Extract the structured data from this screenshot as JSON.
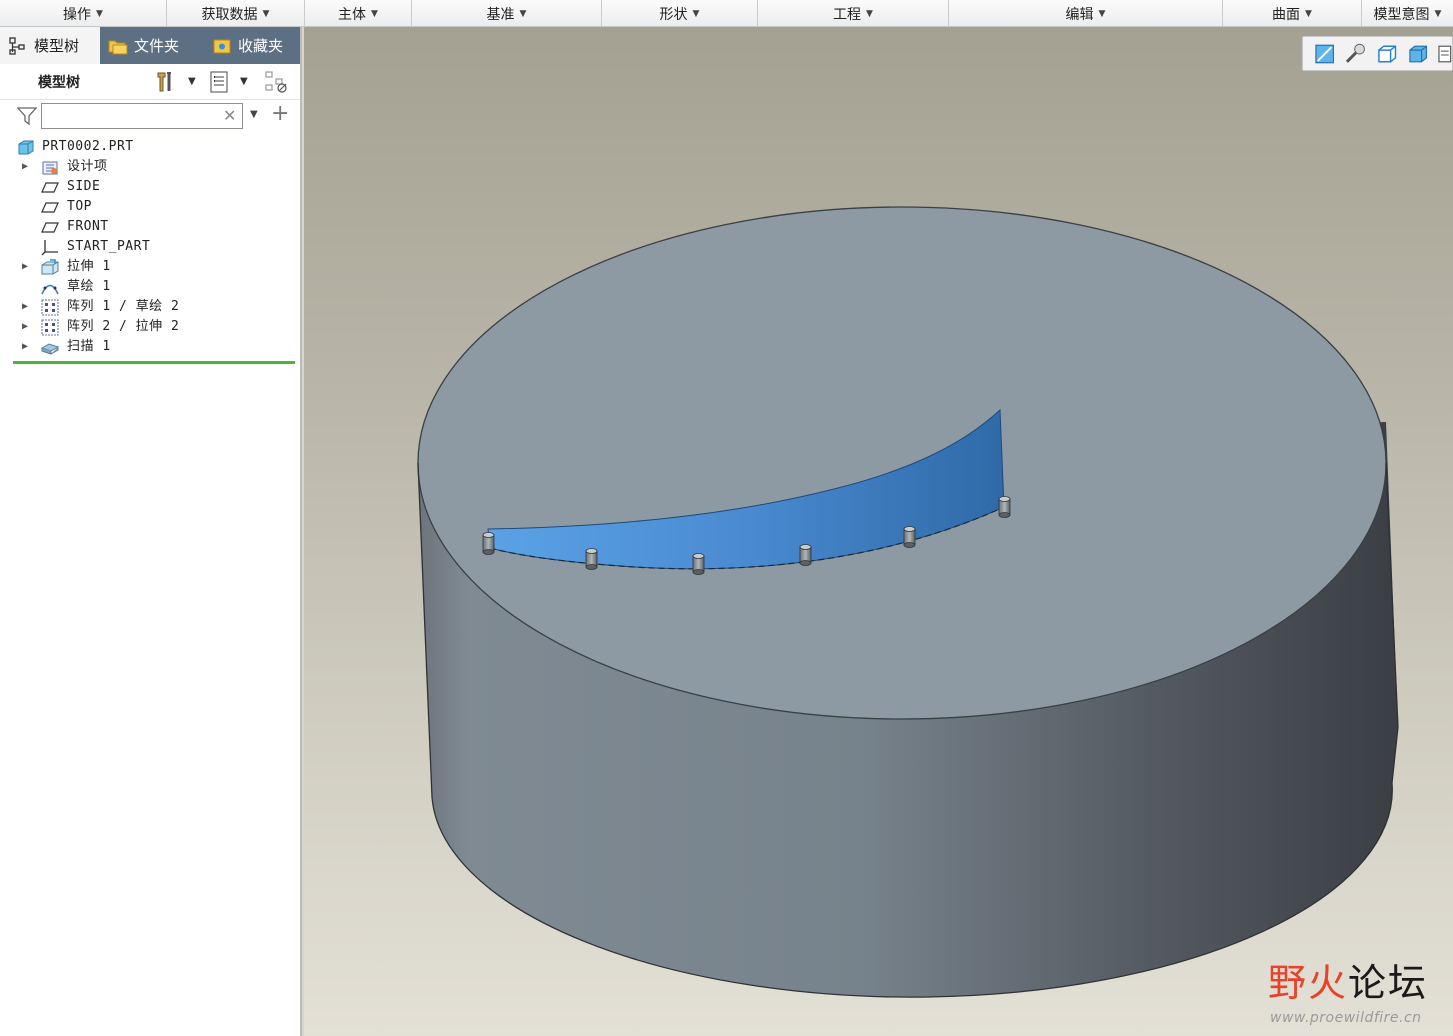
{
  "ribbon": {
    "groups": [
      {
        "label": "操作"
      },
      {
        "label": "获取数据"
      },
      {
        "label": "主体"
      },
      {
        "label": "基准"
      },
      {
        "label": "形状"
      },
      {
        "label": "工程"
      },
      {
        "label": "编辑"
      },
      {
        "label": "曲面"
      },
      {
        "label": "模型意图"
      }
    ]
  },
  "left_panel": {
    "tabs": [
      {
        "label": "模型树",
        "icon": "model-tree-icon"
      },
      {
        "label": "文件夹",
        "icon": "folder-browser-icon"
      },
      {
        "label": "收藏夹",
        "icon": "favorites-icon"
      }
    ],
    "tree_header": {
      "title": "模型树",
      "tools": [
        "settings-tools-icon",
        "show-columns-icon",
        "display-filter-icon"
      ]
    },
    "filter": {
      "placeholder": "",
      "value": ""
    },
    "tree": {
      "root": "PRT0002.PRT",
      "items": [
        {
          "label": "设计项",
          "expandable": true,
          "icon": "design-items-icon"
        },
        {
          "label": "SIDE",
          "expandable": false,
          "icon": "datum-plane-icon"
        },
        {
          "label": "TOP",
          "expandable": false,
          "icon": "datum-plane-icon"
        },
        {
          "label": "FRONT",
          "expandable": false,
          "icon": "datum-plane-icon"
        },
        {
          "label": "START_PART",
          "expandable": false,
          "icon": "coordinate-system-icon"
        },
        {
          "label": "拉伸 1",
          "expandable": true,
          "icon": "extrude-icon"
        },
        {
          "label": "草绘 1",
          "expandable": false,
          "icon": "sketch-icon"
        },
        {
          "label": "阵列 1 / 草绘 2",
          "expandable": true,
          "icon": "pattern-icon"
        },
        {
          "label": "阵列 2 / 拉伸 2",
          "expandable": true,
          "icon": "pattern-icon"
        },
        {
          "label": "扫描 1",
          "expandable": true,
          "icon": "sweep-icon"
        }
      ]
    }
  },
  "view_toolbar": {
    "buttons": [
      "refit-icon",
      "zoom-in-icon",
      "saved-orientations-icon",
      "shading-style-icon",
      "datum-display-icon"
    ]
  },
  "colors": {
    "tab_bar": "#5d6f82",
    "insert_line": "#4fb33a",
    "model_top": "#8e9aa3",
    "model_side_dark": "#3f4348",
    "sweep_surface": "#4a8ad0"
  },
  "watermark": {
    "fire_char": "野火",
    "rest": "论坛",
    "url": "www.proewildfire.cn"
  }
}
